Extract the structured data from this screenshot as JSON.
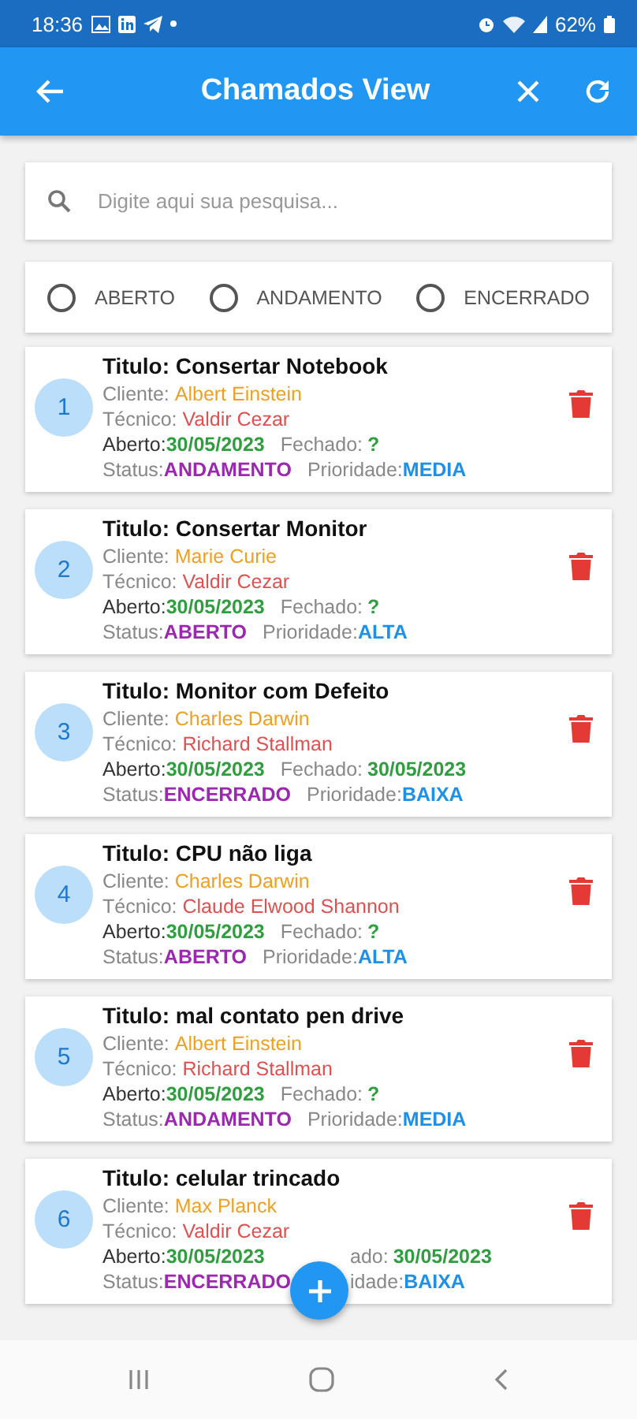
{
  "status_bar": {
    "time": "18:36",
    "battery": "62%"
  },
  "app_bar": {
    "title": "Chamados View"
  },
  "search": {
    "placeholder": "Digite aqui sua pesquisa..."
  },
  "filters": [
    {
      "label": "ABERTO",
      "selected": false
    },
    {
      "label": "ANDAMENTO",
      "selected": false
    },
    {
      "label": "ENCERRADO",
      "selected": false
    }
  ],
  "chamados": [
    {
      "number": "1",
      "title": "Titulo: Consertar Notebook",
      "cliente_label": "Cliente:",
      "cliente": "Albert Einstein",
      "tecnico_label": "Técnico:",
      "tecnico": "Valdir Cezar",
      "aberto_label": "Aberto:",
      "aberto": "30/05/2023",
      "fechado_label": "Fechado:",
      "fechado": "?",
      "status_label": "Status:",
      "status": "ANDAMENTO",
      "prioridade_label": "Prioridade:",
      "prioridade": "MEDIA",
      "partly_hidden": false
    },
    {
      "number": "2",
      "title": "Titulo: Consertar Monitor",
      "cliente_label": "Cliente:",
      "cliente": "Marie Curie",
      "tecnico_label": "Técnico:",
      "tecnico": "Valdir Cezar",
      "aberto_label": "Aberto:",
      "aberto": "30/05/2023",
      "fechado_label": "Fechado:",
      "fechado": "?",
      "status_label": "Status:",
      "status": "ABERTO",
      "prioridade_label": "Prioridade:",
      "prioridade": "ALTA",
      "partly_hidden": false
    },
    {
      "number": "3",
      "title": "Titulo: Monitor com Defeito",
      "cliente_label": "Cliente:",
      "cliente": "Charles Darwin",
      "tecnico_label": "Técnico:",
      "tecnico": "Richard Stallman",
      "aberto_label": "Aberto:",
      "aberto": "30/05/2023",
      "fechado_label": "Fechado:",
      "fechado": "30/05/2023",
      "status_label": "Status:",
      "status": "ENCERRADO",
      "prioridade_label": "Prioridade:",
      "prioridade": "BAIXA",
      "partly_hidden": false
    },
    {
      "number": "4",
      "title": "Titulo: CPU não liga",
      "cliente_label": "Cliente:",
      "cliente": "Charles Darwin",
      "tecnico_label": "Técnico:",
      "tecnico": "Claude Elwood Shannon",
      "aberto_label": "Aberto:",
      "aberto": "30/05/2023",
      "fechado_label": "Fechado:",
      "fechado": "?",
      "status_label": "Status:",
      "status": "ABERTO",
      "prioridade_label": "Prioridade:",
      "prioridade": "ALTA",
      "partly_hidden": false
    },
    {
      "number": "5",
      "title": "Titulo: mal contato pen drive",
      "cliente_label": "Cliente:",
      "cliente": "Albert Einstein",
      "tecnico_label": "Técnico:",
      "tecnico": "Richard Stallman",
      "aberto_label": "Aberto:",
      "aberto": "30/05/2023",
      "fechado_label": "Fechado:",
      "fechado": "?",
      "status_label": "Status:",
      "status": "ANDAMENTO",
      "prioridade_label": "Prioridade:",
      "prioridade": "MEDIA",
      "partly_hidden": false
    },
    {
      "number": "6",
      "title": "Titulo: celular trincado",
      "cliente_label": "Cliente:",
      "cliente": "Max Planck",
      "tecnico_label": "Técnico:",
      "tecnico": "Valdir Cezar",
      "aberto_label": "Aberto:",
      "aberto": "30/05/2023",
      "fechado_label": "ado:",
      "fechado": "30/05/2023",
      "status_label": "Status:",
      "status": "ENCERRADO",
      "prioridade_label": "idade:",
      "prioridade": "BAIXA",
      "partly_hidden": true
    }
  ]
}
